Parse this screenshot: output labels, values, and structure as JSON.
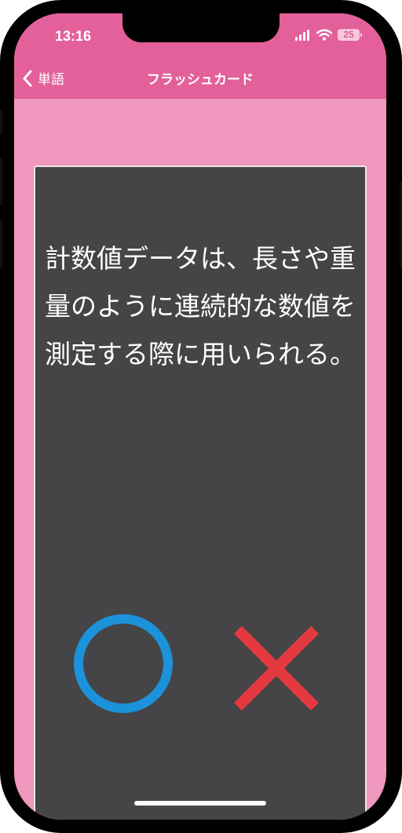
{
  "status_bar": {
    "time": "13:16",
    "battery": "25",
    "icons": [
      "signal-icon",
      "wifi-icon",
      "battery-icon"
    ]
  },
  "nav": {
    "back_label": "単語",
    "title": "フラッシュカード",
    "back_icon": "chevron-left-icon"
  },
  "card": {
    "text": "計数値データは、長さや重量のように連続的な数値を測定する際に用いられる。",
    "answer_buttons": [
      {
        "name": "correct-button",
        "icon": "circle-icon",
        "color": "#1b92d9"
      },
      {
        "name": "wrong-button",
        "icon": "cross-icon",
        "color": "#e43a3f"
      }
    ]
  },
  "colors": {
    "header": "#e3609a",
    "background": "#f097bd",
    "card": "#454446",
    "card_border": "#e8e8e8",
    "circle": "#1b92d9",
    "cross": "#e43a3f"
  }
}
